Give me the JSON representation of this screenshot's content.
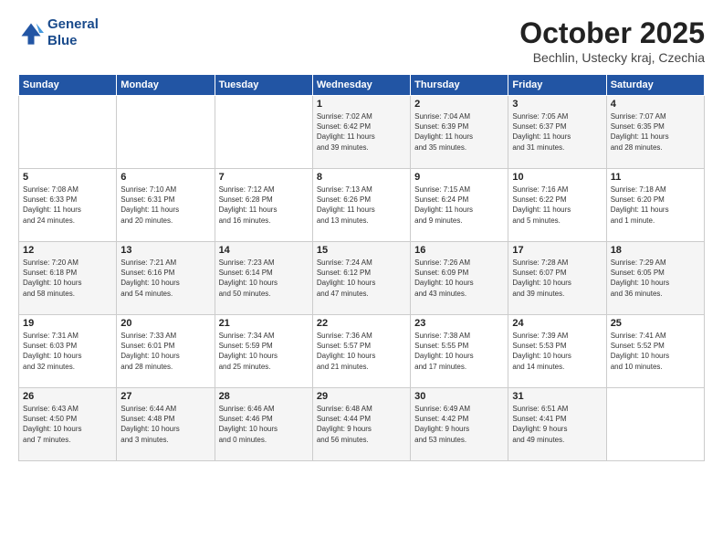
{
  "header": {
    "logo_line1": "General",
    "logo_line2": "Blue",
    "title": "October 2025",
    "subtitle": "Bechlin, Ustecky kraj, Czechia"
  },
  "weekdays": [
    "Sunday",
    "Monday",
    "Tuesday",
    "Wednesday",
    "Thursday",
    "Friday",
    "Saturday"
  ],
  "weeks": [
    [
      {
        "day": "",
        "content": ""
      },
      {
        "day": "",
        "content": ""
      },
      {
        "day": "",
        "content": ""
      },
      {
        "day": "1",
        "content": "Sunrise: 7:02 AM\nSunset: 6:42 PM\nDaylight: 11 hours\nand 39 minutes."
      },
      {
        "day": "2",
        "content": "Sunrise: 7:04 AM\nSunset: 6:39 PM\nDaylight: 11 hours\nand 35 minutes."
      },
      {
        "day": "3",
        "content": "Sunrise: 7:05 AM\nSunset: 6:37 PM\nDaylight: 11 hours\nand 31 minutes."
      },
      {
        "day": "4",
        "content": "Sunrise: 7:07 AM\nSunset: 6:35 PM\nDaylight: 11 hours\nand 28 minutes."
      }
    ],
    [
      {
        "day": "5",
        "content": "Sunrise: 7:08 AM\nSunset: 6:33 PM\nDaylight: 11 hours\nand 24 minutes."
      },
      {
        "day": "6",
        "content": "Sunrise: 7:10 AM\nSunset: 6:31 PM\nDaylight: 11 hours\nand 20 minutes."
      },
      {
        "day": "7",
        "content": "Sunrise: 7:12 AM\nSunset: 6:28 PM\nDaylight: 11 hours\nand 16 minutes."
      },
      {
        "day": "8",
        "content": "Sunrise: 7:13 AM\nSunset: 6:26 PM\nDaylight: 11 hours\nand 13 minutes."
      },
      {
        "day": "9",
        "content": "Sunrise: 7:15 AM\nSunset: 6:24 PM\nDaylight: 11 hours\nand 9 minutes."
      },
      {
        "day": "10",
        "content": "Sunrise: 7:16 AM\nSunset: 6:22 PM\nDaylight: 11 hours\nand 5 minutes."
      },
      {
        "day": "11",
        "content": "Sunrise: 7:18 AM\nSunset: 6:20 PM\nDaylight: 11 hours\nand 1 minute."
      }
    ],
    [
      {
        "day": "12",
        "content": "Sunrise: 7:20 AM\nSunset: 6:18 PM\nDaylight: 10 hours\nand 58 minutes."
      },
      {
        "day": "13",
        "content": "Sunrise: 7:21 AM\nSunset: 6:16 PM\nDaylight: 10 hours\nand 54 minutes."
      },
      {
        "day": "14",
        "content": "Sunrise: 7:23 AM\nSunset: 6:14 PM\nDaylight: 10 hours\nand 50 minutes."
      },
      {
        "day": "15",
        "content": "Sunrise: 7:24 AM\nSunset: 6:12 PM\nDaylight: 10 hours\nand 47 minutes."
      },
      {
        "day": "16",
        "content": "Sunrise: 7:26 AM\nSunset: 6:09 PM\nDaylight: 10 hours\nand 43 minutes."
      },
      {
        "day": "17",
        "content": "Sunrise: 7:28 AM\nSunset: 6:07 PM\nDaylight: 10 hours\nand 39 minutes."
      },
      {
        "day": "18",
        "content": "Sunrise: 7:29 AM\nSunset: 6:05 PM\nDaylight: 10 hours\nand 36 minutes."
      }
    ],
    [
      {
        "day": "19",
        "content": "Sunrise: 7:31 AM\nSunset: 6:03 PM\nDaylight: 10 hours\nand 32 minutes."
      },
      {
        "day": "20",
        "content": "Sunrise: 7:33 AM\nSunset: 6:01 PM\nDaylight: 10 hours\nand 28 minutes."
      },
      {
        "day": "21",
        "content": "Sunrise: 7:34 AM\nSunset: 5:59 PM\nDaylight: 10 hours\nand 25 minutes."
      },
      {
        "day": "22",
        "content": "Sunrise: 7:36 AM\nSunset: 5:57 PM\nDaylight: 10 hours\nand 21 minutes."
      },
      {
        "day": "23",
        "content": "Sunrise: 7:38 AM\nSunset: 5:55 PM\nDaylight: 10 hours\nand 17 minutes."
      },
      {
        "day": "24",
        "content": "Sunrise: 7:39 AM\nSunset: 5:53 PM\nDaylight: 10 hours\nand 14 minutes."
      },
      {
        "day": "25",
        "content": "Sunrise: 7:41 AM\nSunset: 5:52 PM\nDaylight: 10 hours\nand 10 minutes."
      }
    ],
    [
      {
        "day": "26",
        "content": "Sunrise: 6:43 AM\nSunset: 4:50 PM\nDaylight: 10 hours\nand 7 minutes."
      },
      {
        "day": "27",
        "content": "Sunrise: 6:44 AM\nSunset: 4:48 PM\nDaylight: 10 hours\nand 3 minutes."
      },
      {
        "day": "28",
        "content": "Sunrise: 6:46 AM\nSunset: 4:46 PM\nDaylight: 10 hours\nand 0 minutes."
      },
      {
        "day": "29",
        "content": "Sunrise: 6:48 AM\nSunset: 4:44 PM\nDaylight: 9 hours\nand 56 minutes."
      },
      {
        "day": "30",
        "content": "Sunrise: 6:49 AM\nSunset: 4:42 PM\nDaylight: 9 hours\nand 53 minutes."
      },
      {
        "day": "31",
        "content": "Sunrise: 6:51 AM\nSunset: 4:41 PM\nDaylight: 9 hours\nand 49 minutes."
      },
      {
        "day": "",
        "content": ""
      }
    ]
  ]
}
